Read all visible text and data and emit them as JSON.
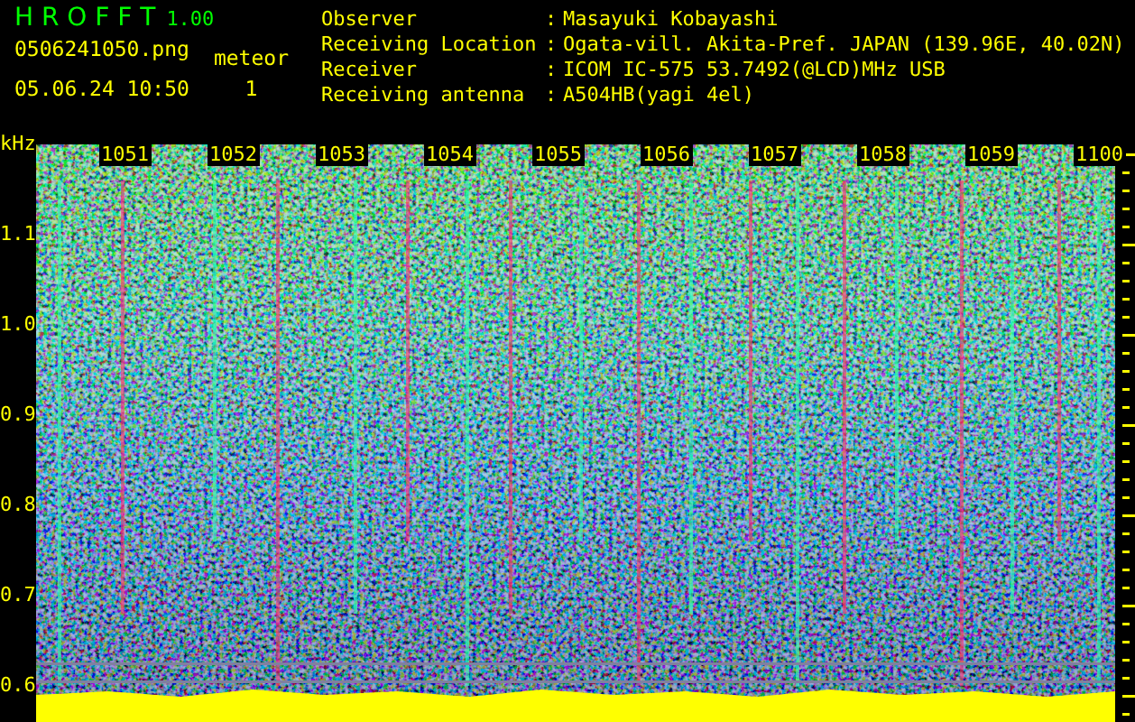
{
  "header": {
    "app_title": "H R O F F T",
    "version": "1.00",
    "filename": "0506241050.png",
    "datetime": "05.06.24 10:50",
    "counter_label": "meteor",
    "counter_value": "1"
  },
  "info": [
    {
      "label": "Observer",
      "separator": ":",
      "value": "Masayuki Kobayashi"
    },
    {
      "label": "Receiving Location",
      "separator": ":",
      "value": "Ogata-vill. Akita-Pref. JAPAN (139.96E, 40.02N)"
    },
    {
      "label": "Receiver",
      "separator": ":",
      "value": "ICOM IC-575 53.7492(@LCD)MHz USB"
    },
    {
      "label": "Receiving antenna",
      "separator": ":",
      "value": "A504HB(yagi 4el)"
    }
  ],
  "spectrogram": {
    "unit": "kHz",
    "y_ticks": [
      "1.1",
      "1.0",
      "0.9",
      "0.8",
      "0.7",
      "0.6"
    ],
    "time_labels": [
      "1051",
      "1052",
      "1053",
      "1054",
      "1055",
      "1056",
      "1057",
      "1058",
      "1059",
      "1100"
    ]
  }
}
